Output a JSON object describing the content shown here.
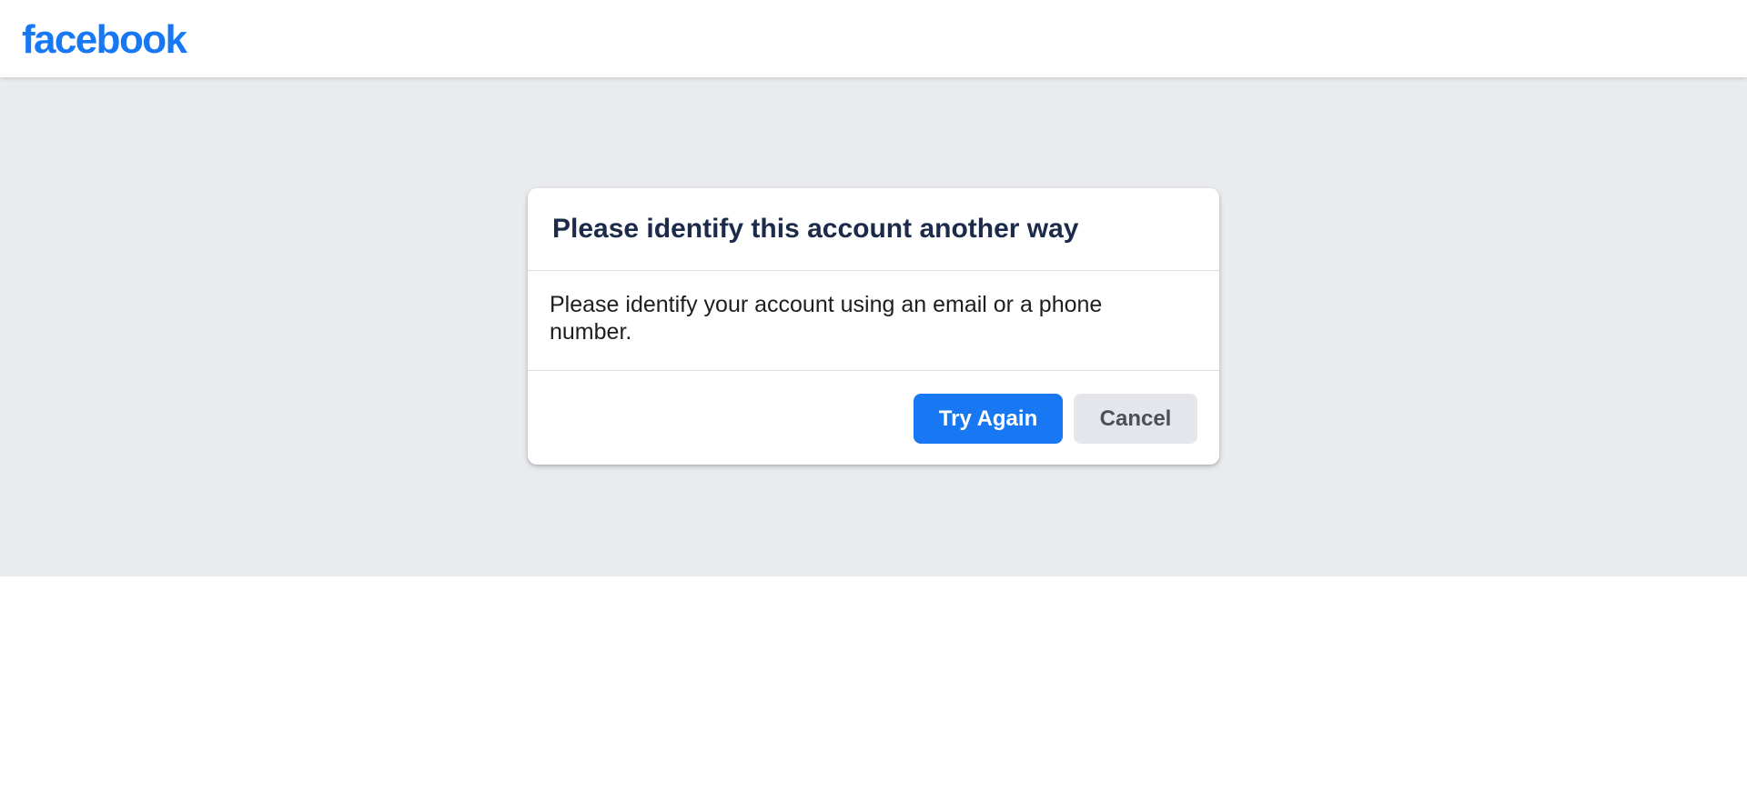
{
  "header": {
    "logo_text": "facebook"
  },
  "dialog": {
    "title": "Please identify this account another way",
    "message": "Please identify your account using an email or a phone number.",
    "primary_button": "Try Again",
    "secondary_button": "Cancel"
  },
  "colors": {
    "brand": "#1877f2",
    "background": "#e9ebee"
  }
}
